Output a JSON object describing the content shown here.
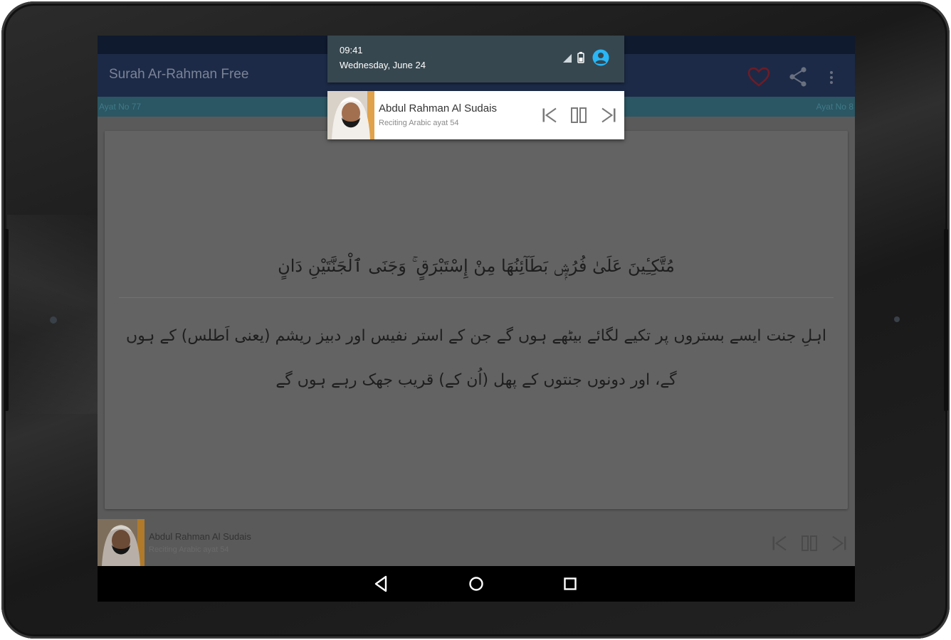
{
  "app": {
    "title": "Surah Ar-Rahman Free",
    "ayat_left": "Ayat No 77",
    "ayat_right": "Ayat No 8"
  },
  "status_shade": {
    "time": "09:41",
    "date": "Wednesday, June 24"
  },
  "notification": {
    "reciter": "Abdul Rahman Al Sudais",
    "status": "Reciting Arabic ayat 54"
  },
  "verse": {
    "arabic": "مُتَّكِـِٔينَ عَلَىٰ فُرُشٍۭ بَطَآئِنُهَا مِنْ إِسْتَبْرَقٍ ۚ وَجَنَى ٱلْجَنَّتَيْنِ دَانٍ",
    "urdu": "اہلِ جنت ایسے بستروں پر تکیے لگائے بیٹھے ہوں گے جن کے استر نفیس اور دبیز ریشم (یعنی اَطلس) کے ہوں گے، اور دونوں جنتوں کے پھل (اُن کے) قریب جھک رہے ہوں گے"
  },
  "player": {
    "reciter": "Abdul Rahman Al Sudais",
    "status": "Reciting Arabic ayat 54"
  },
  "icons": {
    "favorite": "heart-icon",
    "share": "share-icon",
    "overflow": "more-vert-icon",
    "previous": "skip-previous-icon",
    "pause": "pause-icon",
    "next": "skip-next-icon",
    "nav_back": "back-icon",
    "nav_home": "home-icon",
    "nav_recents": "recents-icon"
  },
  "colors": {
    "app_bar": "#1c2a47",
    "ayat_strip": "#2b5663",
    "shade": "#37474f",
    "favorite": "#7a1f2a",
    "account": "#29b6f6"
  }
}
